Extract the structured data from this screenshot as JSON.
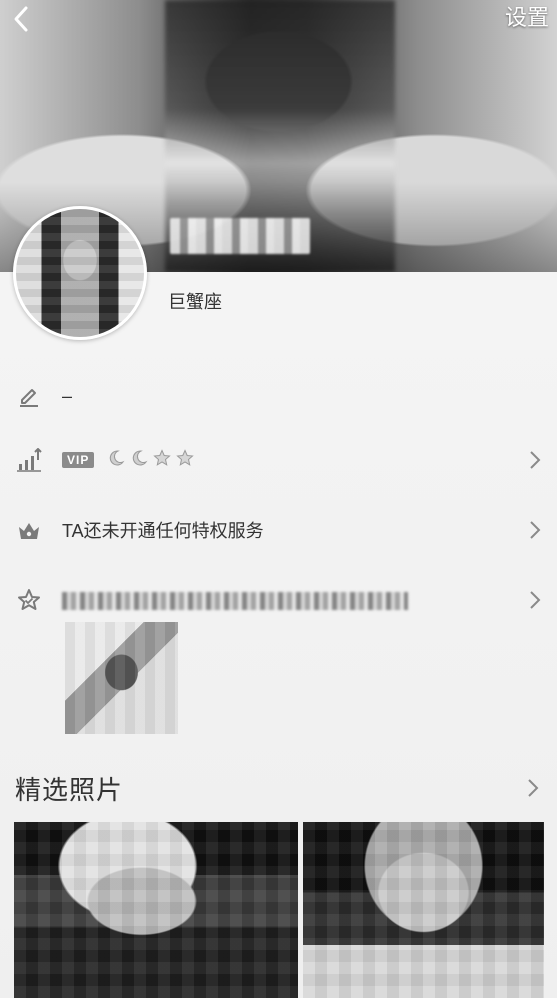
{
  "header": {
    "settings_label": "设置",
    "back_icon": "chevron-left-icon"
  },
  "profile": {
    "zodiac": "巨蟹座"
  },
  "rows": {
    "signature": {
      "icon": "pencil-icon",
      "text": "–"
    },
    "level": {
      "icon": "level-chart-icon",
      "badge": "VIP",
      "level_icons": [
        "moon-icon",
        "moon-icon",
        "star-icon",
        "star-icon"
      ]
    },
    "privilege": {
      "icon": "crown-icon",
      "text": "TA还未开通任何特权服务"
    },
    "favorite": {
      "icon": "star-outline-icon"
    }
  },
  "photos": {
    "title": "精选照片"
  }
}
